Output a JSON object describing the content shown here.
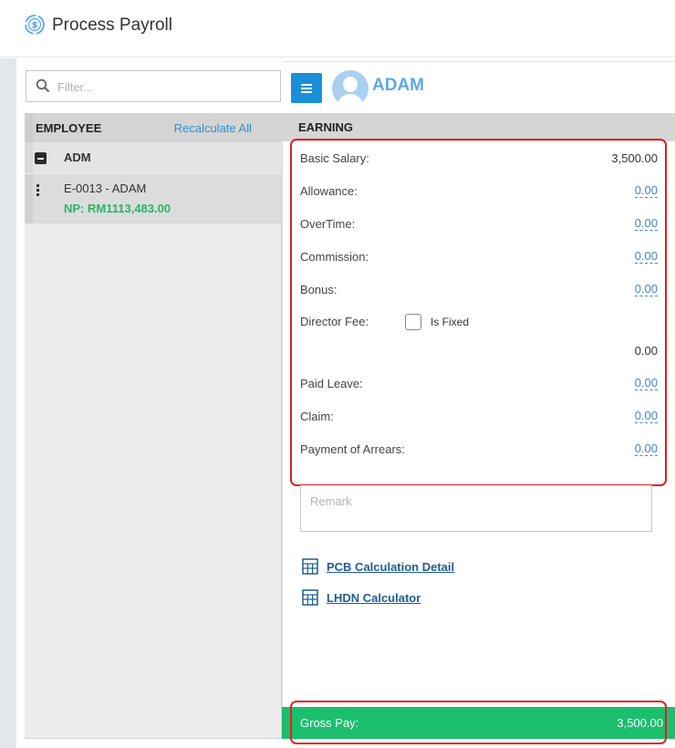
{
  "header": {
    "title": "Process Payroll",
    "icon": "payroll-cycle-icon"
  },
  "left": {
    "filter_placeholder": "Filter...",
    "employee_header": "EMPLOYEE",
    "recalculate_label": "Recalculate All",
    "group_label": "ADM",
    "employee": {
      "code_name": "E-0013 - ADAM",
      "net_pay": "NP: RM1113,483.00"
    }
  },
  "right": {
    "employee_name": "ADAM",
    "section_title": "EARNING",
    "fields": {
      "basic_salary": {
        "label": "Basic Salary:",
        "value": "3,500.00"
      },
      "allowance": {
        "label": "Allowance:",
        "value": "0.00"
      },
      "overtime": {
        "label": "OverTime:",
        "value": "0.00"
      },
      "commission": {
        "label": "Commission:",
        "value": "0.00"
      },
      "bonus": {
        "label": "Bonus:",
        "value": "0.00"
      },
      "director_fee": {
        "label": "Director Fee:",
        "fixed_label": "Is Fixed",
        "value": "0.00"
      },
      "paid_leave": {
        "label": "Paid Leave:",
        "value": "0.00"
      },
      "claim": {
        "label": "Claim:",
        "value": "0.00"
      },
      "arrears": {
        "label": "Payment of Arrears:",
        "value": "0.00"
      }
    },
    "remark_placeholder": "Remark",
    "pcb_link": "PCB Calculation Detail",
    "lhdn_link": "LHDN Calculator",
    "gross_pay": {
      "label": "Gross Pay:",
      "value": "3,500.00"
    }
  },
  "colors": {
    "accent": "#1a8fd8",
    "success": "#1bbf6e",
    "highlight": "#e01f1f",
    "link": "#1f5d91"
  }
}
